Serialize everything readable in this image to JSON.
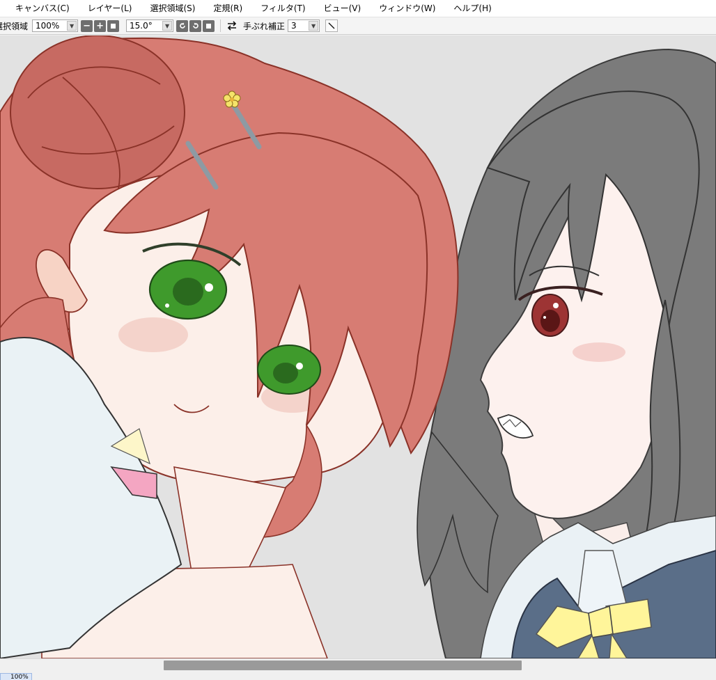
{
  "menubar": {
    "items": [
      {
        "label": "キャンバス(C)"
      },
      {
        "label": "レイヤー(L)"
      },
      {
        "label": "選択領域(S)"
      },
      {
        "label": "定規(R)"
      },
      {
        "label": "フィルタ(T)"
      },
      {
        "label": "ビュー(V)"
      },
      {
        "label": "ウィンドウ(W)"
      },
      {
        "label": "ヘルプ(H)"
      }
    ]
  },
  "toolbar": {
    "selection_label": "選択領域",
    "zoom_value": "100%",
    "rotation_value": "15.0°",
    "stabilizer_label": "手ぶれ補正",
    "stabilizer_value": "3"
  },
  "statusbar": {
    "zoom": "100%"
  },
  "colors": {
    "hair_left": "#d77c73",
    "hair_right": "#7b7b7b",
    "eyes_left": "#3f9a2c",
    "eyes_right": "#9d3434",
    "ribbon": "#fff59a",
    "vest": "#5a6e88",
    "canvas_bg": "#e2e2e2"
  },
  "icons": {
    "zoom_out": "minus-icon",
    "zoom_in": "plus-icon",
    "zoom_reset": "square-icon",
    "rotate_left": "rotate-left-icon",
    "rotate_right": "rotate-right-icon",
    "rotate_reset": "square-icon",
    "flip": "flip-horizontal-icon",
    "pen": "diagonal-line-icon"
  }
}
